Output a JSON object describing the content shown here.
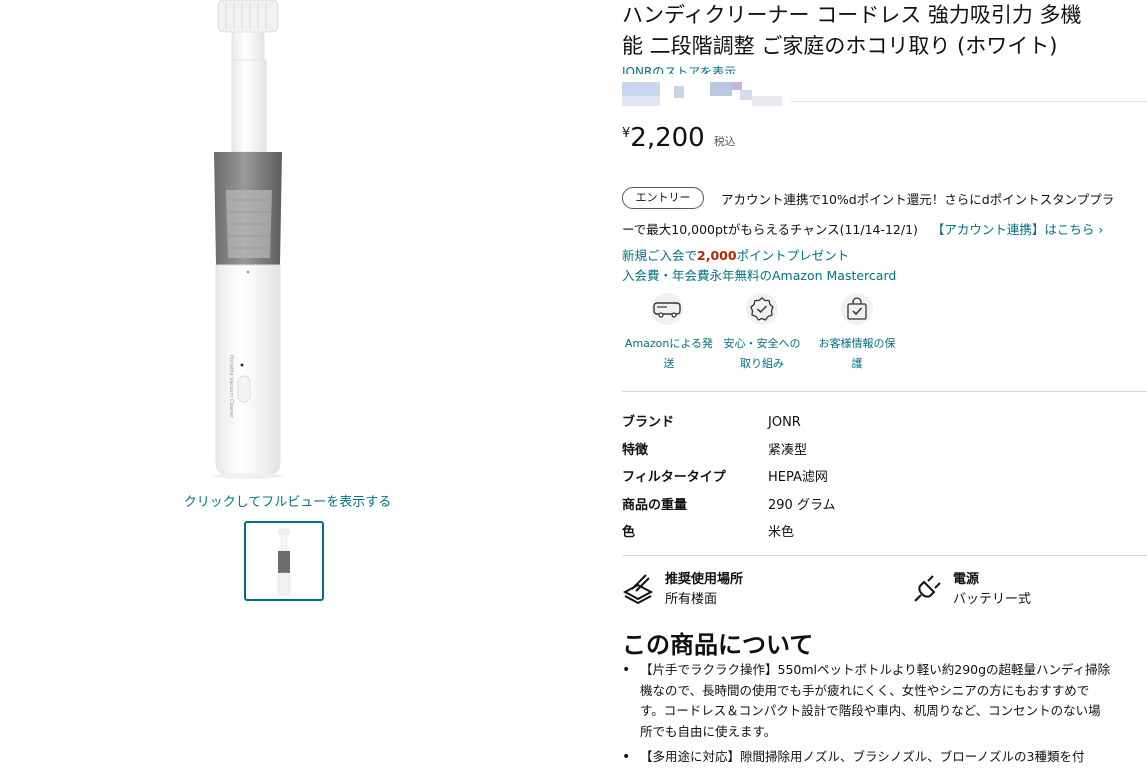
{
  "product": {
    "title_line1": "ハンディクリーナー コードレス 強力吸引力 多機",
    "title_line2": "能 二段階調整 ご家庭のホコリ取り (ホワイト)",
    "store_link": "JONRのストアを表示"
  },
  "gallery": {
    "fullview_label": "クリックしてフルビューを表示する"
  },
  "price": {
    "currency_symbol": "¥",
    "amount": "2,200",
    "tax_label": "税込"
  },
  "promo": {
    "badge": "エントリー",
    "line1": "アカウント連携で10%dポイント還元！さらにdポイントスタンププラ",
    "line2_prefix": "ーで最大10,000ptがもらえるチャンス(11/14-12/1)",
    "line2_link": "【アカウント連携】はこちら ›",
    "newmember_prefix": "新規ご入会で",
    "newmember_points": "2,000",
    "newmember_suffix": "ポイントプレゼント",
    "mastercard": "入会費・年会費永年無料のAmazon Mastercard"
  },
  "features": [
    {
      "icon": "delivery-truck-icon",
      "line1": "Amazonによる発",
      "line2": "送"
    },
    {
      "icon": "safety-badge-icon",
      "line1": "安心・安全への",
      "line2": "取り組み"
    },
    {
      "icon": "secure-bag-icon",
      "line1": "お客様情報の保",
      "line2": "護"
    }
  ],
  "specs": [
    {
      "key": "ブランド",
      "value": "JONR"
    },
    {
      "key": "特徴",
      "value": "紧凑型"
    },
    {
      "key": "フィルタータイプ",
      "value": "HEPA滤网"
    },
    {
      "key": "商品の重量",
      "value": "290 グラム"
    },
    {
      "key": "色",
      "value": "米色"
    }
  ],
  "usage": {
    "place_title": "推奨使用場所",
    "place_value": "所有楼面",
    "power_title": "電源",
    "power_value": "バッテリー式"
  },
  "about": {
    "title": "この商品について",
    "bullets": [
      "【片手でラクラク操作】550mlペットボトルより軽い約290gの超軽量ハンディ掃除\n機なので、長時間の使用でも手が疲れにくく、女性やシニアの方にもおすすめで\nす。コードレス＆コンパクト設計で階段や車内、机周りなど、コンセントのない場\n所でも自由に使えます。",
      "【多用途に対応】隙間掃除用ノズル、ブラシノズル、ブローノズルの3種類を付"
    ]
  },
  "colors": {
    "link": "#007185",
    "price_red": "#b12704",
    "text": "#0f1111"
  }
}
